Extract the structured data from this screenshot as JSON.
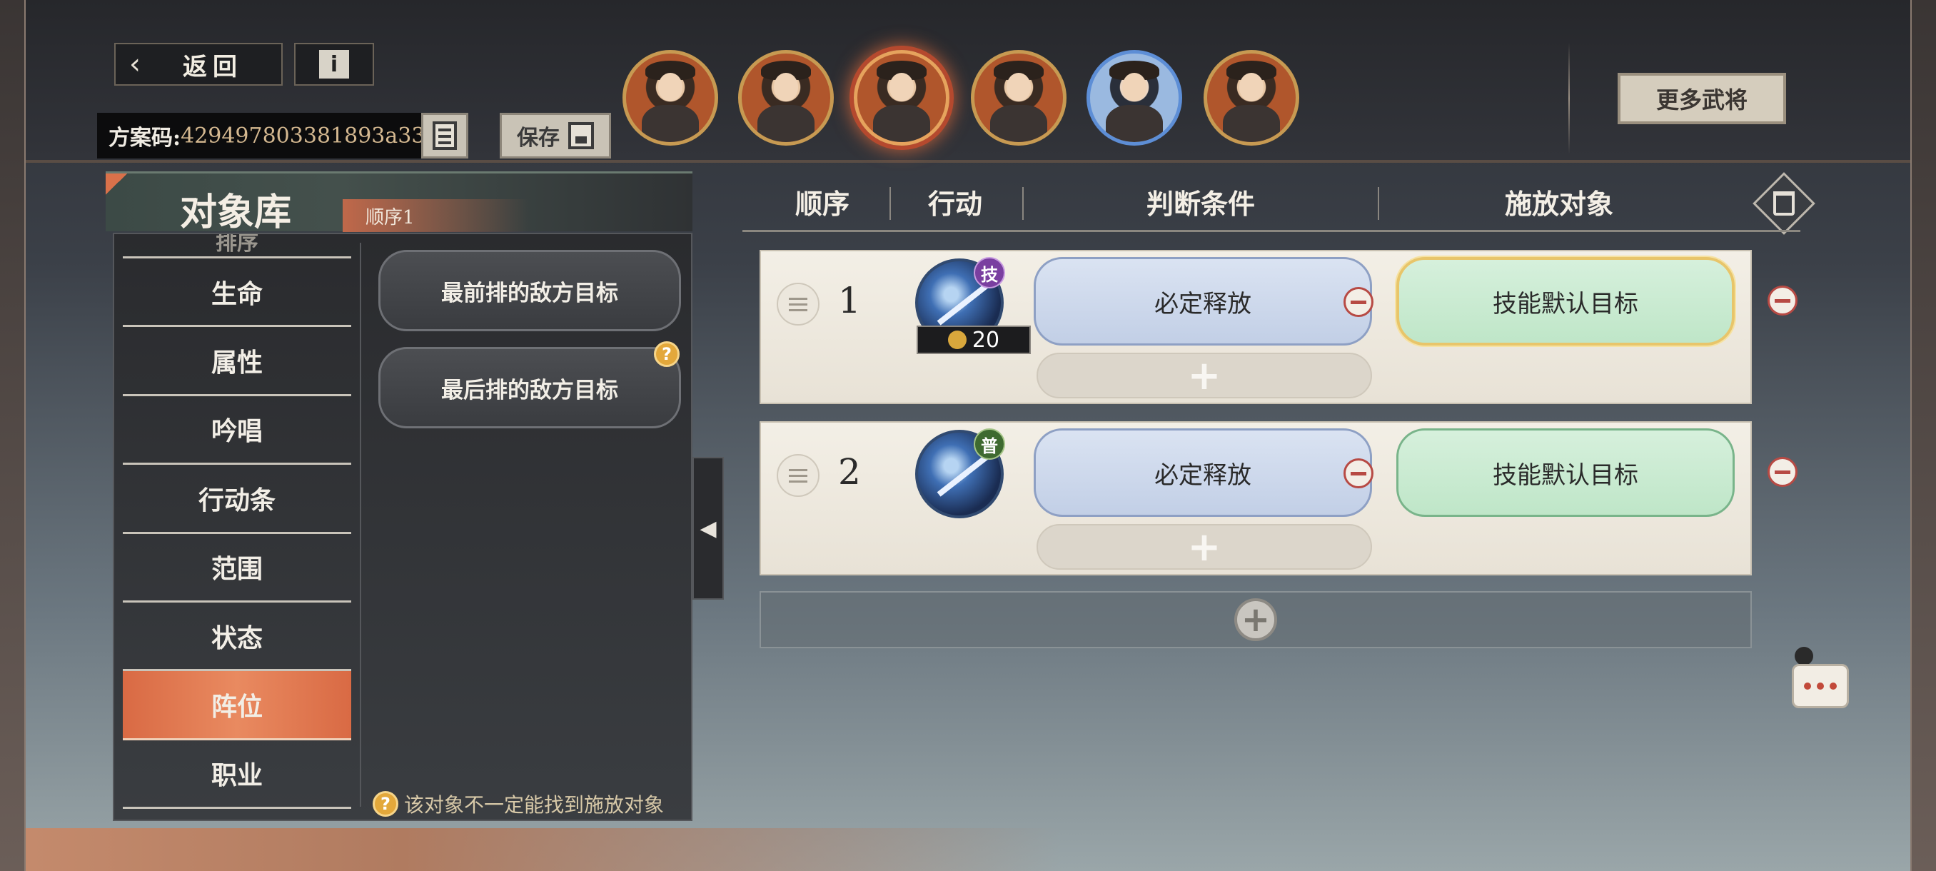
{
  "header": {
    "back_label": "返回",
    "back_arrow_icon": "back-arrow-icon",
    "info_glyph": "i",
    "plan_code_label": "方案码:",
    "plan_code_value": "429497803381893a33",
    "save_label": "保存",
    "more_generals_label": "更多武将"
  },
  "portraits": [
    {
      "name": "general-portrait-1",
      "border": "gold"
    },
    {
      "name": "general-portrait-2",
      "border": "gold"
    },
    {
      "name": "general-portrait-3",
      "border": "gold",
      "selected": true
    },
    {
      "name": "general-portrait-4",
      "border": "gold"
    },
    {
      "name": "general-portrait-5",
      "border": "blue"
    },
    {
      "name": "general-portrait-6",
      "border": "gold"
    }
  ],
  "library": {
    "title": "对象库",
    "order_tag": "顺序1",
    "categories_partial": "排序",
    "categories": [
      "生命",
      "属性",
      "吟唱",
      "行动条",
      "范围",
      "状态",
      "阵位",
      "职业"
    ],
    "active_category": "阵位",
    "targets": [
      {
        "label": "最前排的敌方目标",
        "has_help": false
      },
      {
        "label": "最后排的敌方目标",
        "has_help": true
      }
    ],
    "help_glyph": "?",
    "footnote": "该对象不一定能找到施放对象",
    "collapse_glyph": "◀"
  },
  "table": {
    "headers": {
      "order": "顺序",
      "action": "行动",
      "condition": "判断条件",
      "target": "施放对象"
    },
    "plus_glyph": "+",
    "rows": [
      {
        "number": "1",
        "skill_badge": "技",
        "skill_badge_color": "#7a3fa0",
        "cost": "20",
        "condition": "必定释放",
        "target": "技能默认目标",
        "target_selected": true
      },
      {
        "number": "2",
        "skill_badge": "普",
        "skill_badge_color": "#3e6a30",
        "cost": "",
        "condition": "必定释放",
        "target": "技能默认目标",
        "target_selected": false
      }
    ]
  },
  "colors": {
    "accent_orange": "#d96a44",
    "condition_blue": "#c2cfe6",
    "target_green": "#bfe6c8",
    "minus_red": "#b74a44"
  }
}
